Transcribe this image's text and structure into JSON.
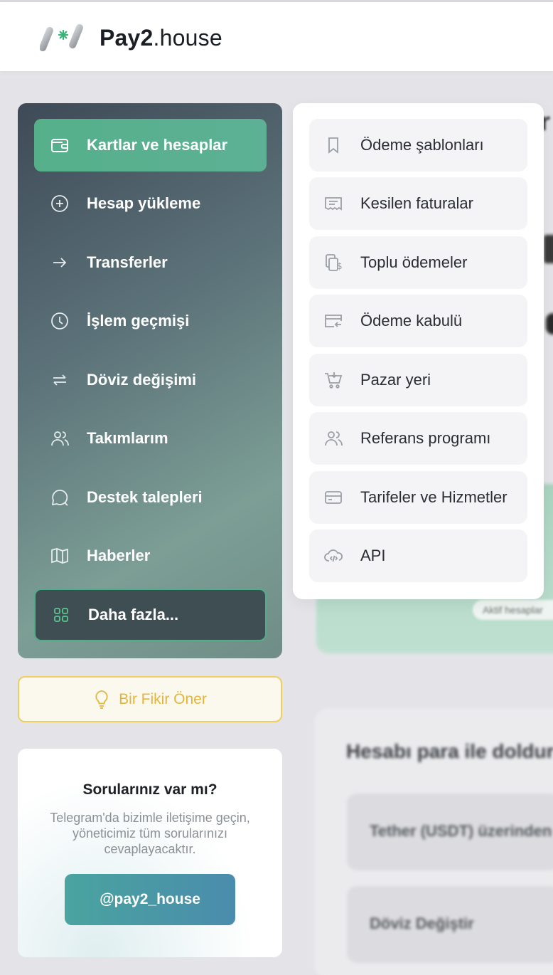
{
  "brand": {
    "name_bold": "Pay2",
    "name_light": ".house"
  },
  "sidebar": {
    "items": [
      {
        "label": "Kartlar ve hesaplar",
        "icon": "wallet-icon",
        "active": true
      },
      {
        "label": "Hesap yükleme",
        "icon": "plus-circle-icon"
      },
      {
        "label": "Transferler",
        "icon": "arrow-right-icon"
      },
      {
        "label": "İşlem geçmişi",
        "icon": "clock-icon"
      },
      {
        "label": "Döviz değişimi",
        "icon": "exchange-icon"
      },
      {
        "label": "Takımlarım",
        "icon": "users-icon"
      },
      {
        "label": "Destek talepleri",
        "icon": "chat-icon"
      },
      {
        "label": "Haberler",
        "icon": "book-icon"
      },
      {
        "label": "Daha fazla...",
        "icon": "grid-icon"
      }
    ]
  },
  "idea_button": {
    "label": "Bir Fikir Öner",
    "icon": "lightbulb-icon"
  },
  "help": {
    "title": "Sorularınız var mı?",
    "text": "Telegram'da bizimle iletişime geçin, yöneticimiz tüm sorularınızı cevaplayacaktır.",
    "button": "@pay2_house"
  },
  "dropdown": {
    "items": [
      {
        "label": "Ödeme şablonları",
        "icon": "bookmark-icon"
      },
      {
        "label": "Kesilen faturalar",
        "icon": "receipt-icon"
      },
      {
        "label": "Toplu ödemeler",
        "icon": "bulk-payment-icon"
      },
      {
        "label": "Ödeme kabulü",
        "icon": "card-in-icon"
      },
      {
        "label": "Pazar yeri",
        "icon": "cart-icon"
      },
      {
        "label": "Referans programı",
        "icon": "users-icon"
      },
      {
        "label": "Tarifeler ve Hizmetler",
        "icon": "card-icon"
      },
      {
        "label": "API",
        "icon": "cloud-code-icon"
      }
    ]
  },
  "background": {
    "pill": "Aktif hesaplar",
    "panel_title": "Hesabı para ile doldur",
    "row1": "Tether (USDT) üzerinden",
    "row2": "Döviz Değiştir"
  },
  "colors": {
    "accent": "#55b08a",
    "idea": "#f0cd62",
    "telegram": "#4a8cad"
  }
}
